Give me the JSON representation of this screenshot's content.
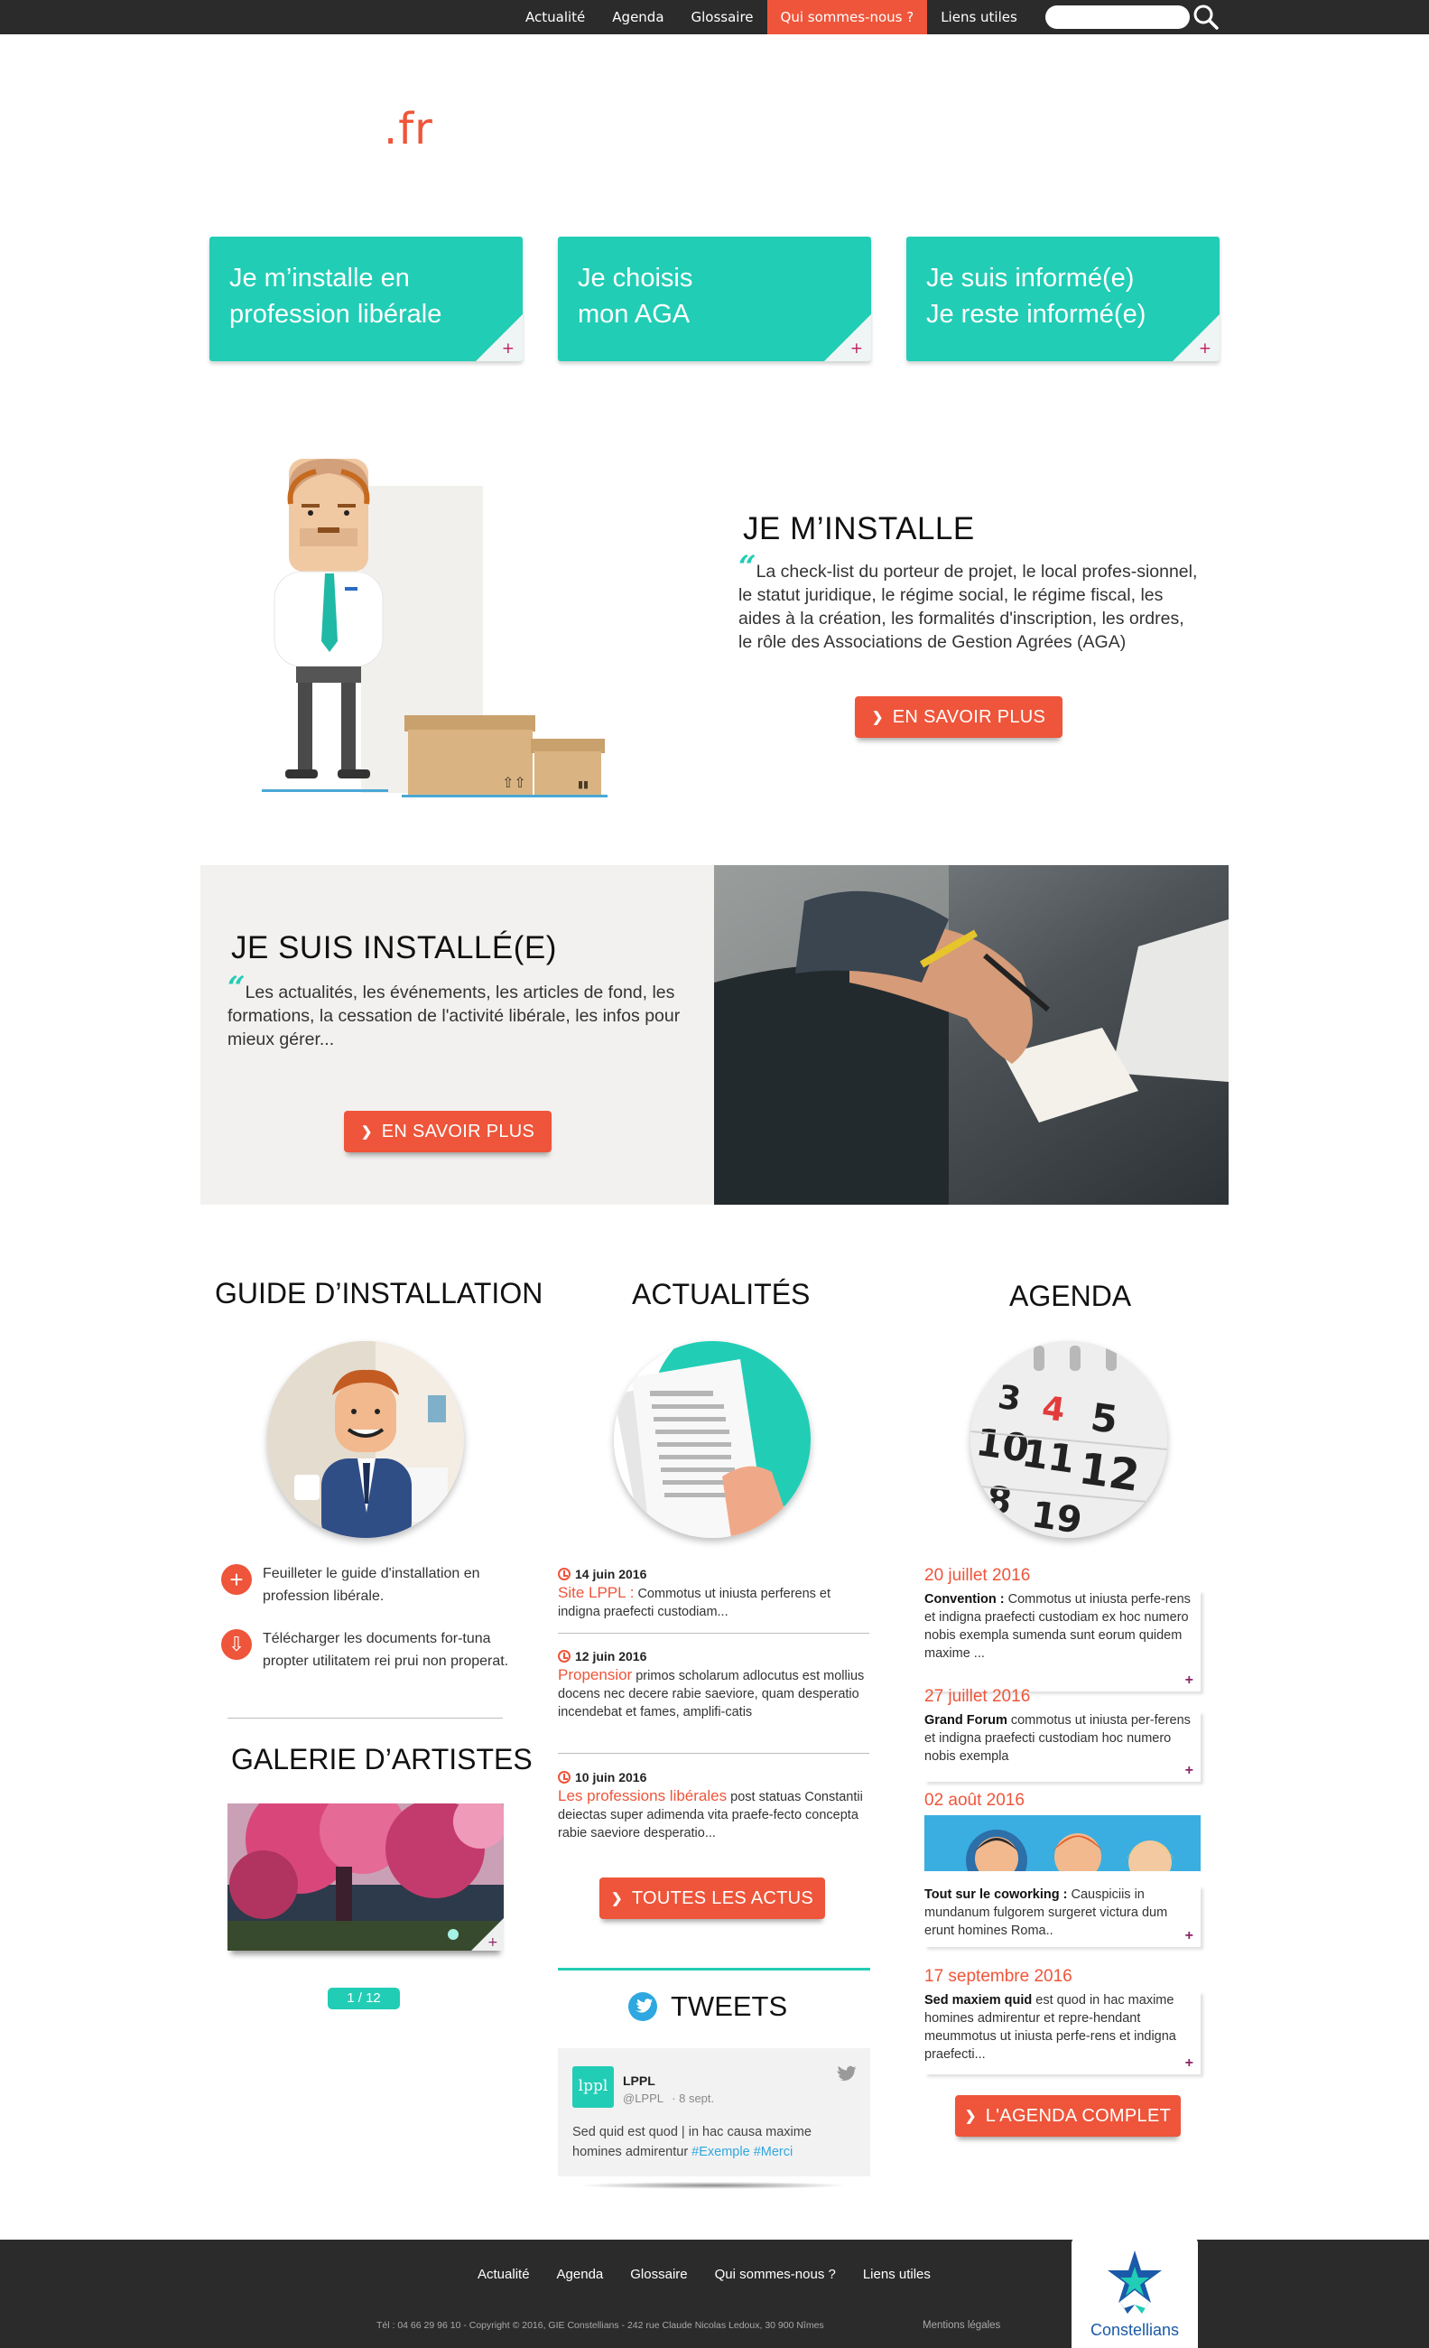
{
  "nav": {
    "items": [
      "Actualité",
      "Agenda",
      "Glossaire",
      "Qui sommes-nous ?",
      "Liens utiles"
    ],
    "active_index": 3,
    "search_placeholder": ""
  },
  "brand": {
    "suffix": ".fr"
  },
  "tiles": [
    {
      "label": "Je m’installe en\nprofession libérale",
      "plus": "+"
    },
    {
      "label": "Je choisis\nmon AGA",
      "plus": "+"
    },
    {
      "label": "Je suis informé(e)\nJe reste informé(e)",
      "plus": "+"
    }
  ],
  "installe": {
    "title": "JE M’INSTALLE",
    "quote_mark": "“",
    "text": "La check-list du porteur de projet, le local profes-sionnel, le statut juridique, le régime social, le régime fiscal, les aides à la création, les formalités d'inscription, les ordres, le rôle des Associations de Gestion Agrées (AGA)",
    "button": "EN SAVOIR PLUS",
    "button_chevron": "❯"
  },
  "installee": {
    "title": "JE SUIS INSTALLÉ(E)",
    "quote_mark": "“",
    "text": "Les actualités, les  événements, les articles de fond, les formations, la cessation de l'activité libérale, les infos pour mieux gérer...",
    "button": "EN SAVOIR PLUS",
    "button_chevron": "❯"
  },
  "guide": {
    "title": "GUIDE D’INSTALLATION",
    "items": [
      {
        "icon": "plus-circle-icon",
        "glyph": "+",
        "text": "Feuilleter le guide d'installation en profession libérale."
      },
      {
        "icon": "download-circle-icon",
        "glyph": "⇩",
        "text": "Télécharger les documents  for-tuna propter utilitatem rei prui non properat."
      }
    ]
  },
  "galerie": {
    "title": "GALERIE D’ARTISTES",
    "pager": "1 / 12",
    "plus": "+"
  },
  "actualites": {
    "title": "ACTUALITÉS",
    "items": [
      {
        "date": "14 juin 2016",
        "highlight": "Site LPPL :",
        "text": " Commotus ut iniusta perferens et indigna praefecti custodiam..."
      },
      {
        "date": "12 juin 2016",
        "highlight": "Propensior",
        "text": " primos scholarum adlocutus est mollius docens nec decere rabie saeviore, quam desperatio incendebat et fames, amplifi-catis"
      },
      {
        "date": "10 juin 2016",
        "highlight": "Les professions libérales",
        "text": " post statuas Constantii deiectas super adimenda vita praefe-fecto concepta rabie saeviore desperatio..."
      }
    ],
    "button": "TOUTES LES ACTUS",
    "button_chevron": "❯"
  },
  "tweets": {
    "title": "TWEETS",
    "author": "LPPL",
    "handle": "@LPPL",
    "date": "· 8 sept.",
    "avatar_text": "lppl",
    "text": "Sed quid est quod | in hac causa maxime homines admirentur ",
    "tag1": "#Exemple",
    "tag2": "#Merci"
  },
  "agenda": {
    "title": "AGENDA",
    "items": [
      {
        "date": "20 juillet 2016",
        "bold": "Convention :",
        "text": " Commotus ut iniusta perfe-rens et indigna praefecti custodiam ex hoc numero nobis exempla sumenda sunt eorum quidem maxime ..."
      },
      {
        "date": "27 juillet 2016",
        "bold": "Grand Forum",
        "text": " commotus ut iniusta per-ferens et indigna praefecti custodiam hoc numero nobis exempla"
      },
      {
        "date": "02 août 2016",
        "bold": "Tout sur le coworking :",
        "text": " Causpiciis in mundanum fulgorem surgeret victura dum erunt homines Roma.."
      },
      {
        "date": "17 septembre 2016",
        "bold": "Sed maxiem quid",
        "text": " est quod in hac maxime homines admirentur et repre-hendant meummotus ut iniusta perfe-rens et indigna praefecti..."
      }
    ],
    "plus": "+",
    "button": "L'AGENDA COMPLET",
    "button_chevron": "❯"
  },
  "footer": {
    "nav": [
      "Actualité",
      "Agenda",
      "Glossaire",
      "Qui sommes-nous ?",
      "Liens utiles"
    ],
    "copyright": "Tél : 04 66 29 96 10 - Copyright © 2016, GIE Constellians - 242 rue Claude Nicolas Ledoux, 30 900 Nîmes",
    "legal": "Mentions légales",
    "logo_text": "Constellians"
  },
  "colors": {
    "accent": "#ee553a",
    "teal": "#22cdb5",
    "dark": "#2b2b2b"
  }
}
